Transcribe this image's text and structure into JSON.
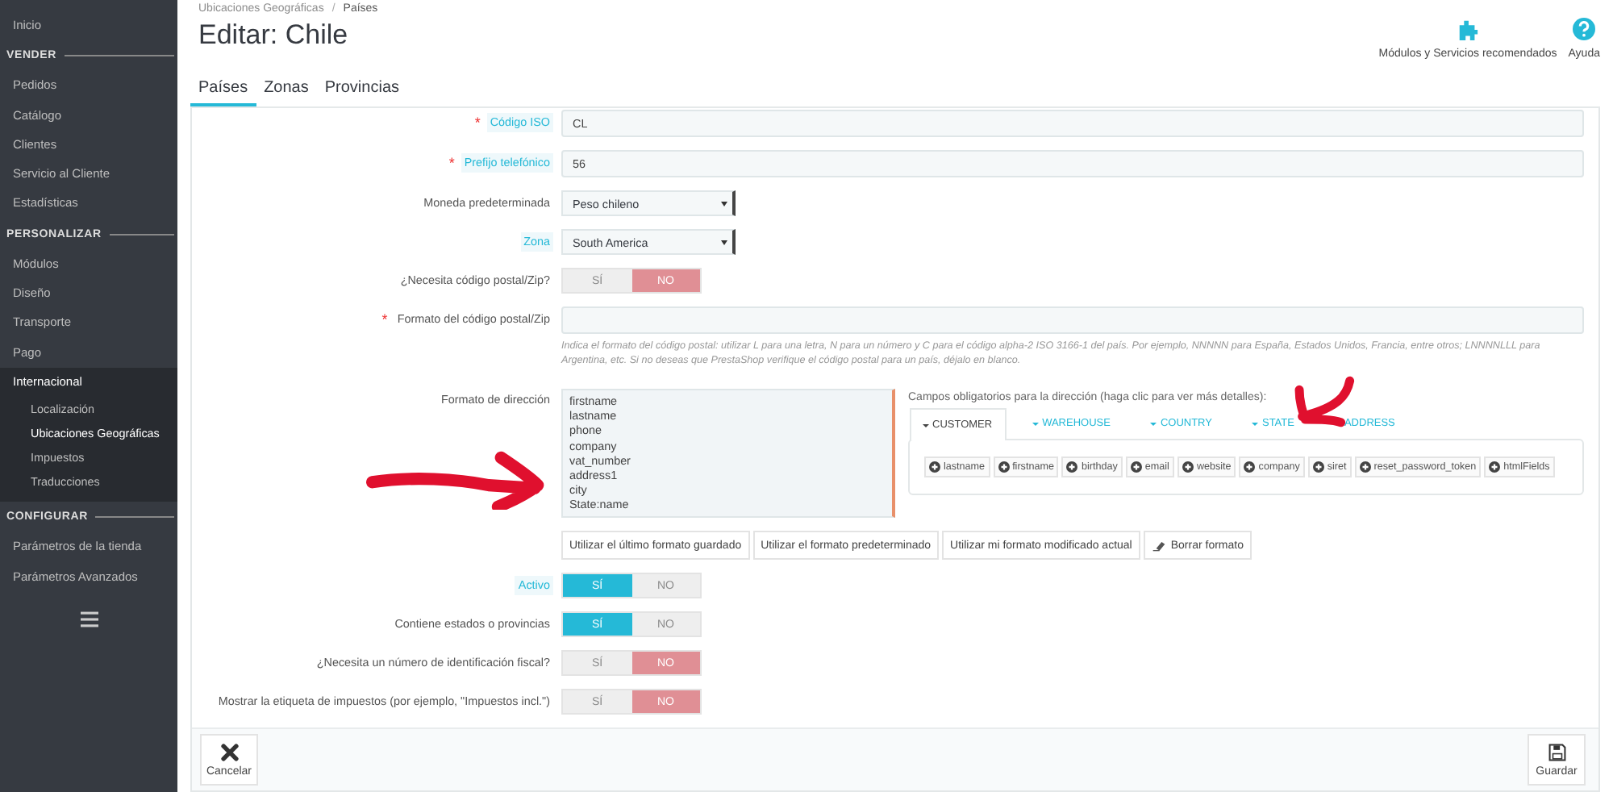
{
  "sidebar": {
    "items": [
      {
        "kind": "link",
        "label": "Inicio",
        "selected": false
      },
      {
        "kind": "heading",
        "label": "VENDER"
      },
      {
        "kind": "link",
        "label": "Pedidos",
        "selected": false
      },
      {
        "kind": "link",
        "label": "Catálogo",
        "selected": false
      },
      {
        "kind": "link",
        "label": "Clientes",
        "selected": false
      },
      {
        "kind": "link",
        "label": "Servicio al Cliente",
        "selected": false
      },
      {
        "kind": "link",
        "label": "Estadísticas",
        "selected": false
      },
      {
        "kind": "heading",
        "label": "PERSONALIZAR"
      },
      {
        "kind": "link",
        "label": "Módulos",
        "selected": false
      },
      {
        "kind": "link",
        "label": "Diseño",
        "selected": false
      },
      {
        "kind": "link",
        "label": "Transporte",
        "selected": false
      },
      {
        "kind": "link",
        "label": "Pago",
        "selected": false
      },
      {
        "kind": "link",
        "label": "Internacional",
        "expanded": true,
        "children": [
          {
            "label": "Localización",
            "selected": false
          },
          {
            "label": "Ubicaciones Geográficas",
            "selected": true
          },
          {
            "label": "Impuestos",
            "selected": false
          },
          {
            "label": "Traducciones",
            "selected": false
          }
        ]
      },
      {
        "kind": "heading",
        "label": "CONFIGURAR"
      },
      {
        "kind": "link",
        "label": "Parámetros de la tienda",
        "selected": false
      },
      {
        "kind": "link",
        "label": "Parámetros Avanzados",
        "selected": false
      }
    ]
  },
  "breadcrumb": [
    "Ubicaciones Geográficas",
    "/",
    "Países"
  ],
  "title": "Editar: Chile",
  "toolbar": [
    {
      "kind": "modules",
      "label": "Módulos y Servicios recomendados"
    },
    {
      "kind": "help",
      "label": "Ayuda"
    }
  ],
  "tabs": [
    {
      "label": "Países",
      "selected": true
    },
    {
      "label": "Zonas",
      "selected": false
    },
    {
      "label": "Provincias",
      "selected": false
    }
  ],
  "form": {
    "fields": [
      {
        "kind": "text",
        "label": "Código ISO",
        "required_mark": "*",
        "tooltip": true,
        "value": "CL"
      },
      {
        "kind": "text",
        "label": "Prefijo telefónico",
        "required_mark": "*",
        "tooltip": true,
        "value": "56"
      },
      {
        "kind": "select",
        "label": "Moneda predeterminada",
        "tooltip": false,
        "value": "Peso chileno"
      },
      {
        "kind": "select",
        "label": "Zona",
        "tooltip": true,
        "value": "South America"
      },
      {
        "kind": "toggle",
        "label": "¿Necesita código postal/Zip?",
        "tooltip": false,
        "options": [
          {
            "label": "SÍ",
            "selected": false
          },
          {
            "label": "NO",
            "selected": true
          }
        ]
      },
      {
        "kind": "text",
        "label": "Formato del código postal/Zip",
        "required_mark": "*",
        "tooltip": false,
        "help": "Indica el formato del código postal: utilizar L para una letra, N para un número y C para el código alpha-2 ISO 3166-1 del país. Por ejemplo, NNNNN para España, Estados Unidos, Francia, entre otros; LNNNNLLL para Argentina, etc. Si no deseas que PrestaShop verifique el código postal para un país, déjalo en blanco."
      },
      {
        "kind": "address",
        "label": "Formato de dirección",
        "tooltip": false,
        "value": "firstname\nlastname\nphone\ncompany\nvat_number\naddress1\ncity\nState:name",
        "fields_heading": "Campos obligatorios para la dirección (haga clic para ver más detalles):",
        "field_tabs": [
          {
            "label": "CUSTOMER",
            "selected": true
          },
          {
            "label": "WAREHOUSE",
            "selected": false
          },
          {
            "label": "COUNTRY",
            "selected": false
          },
          {
            "label": "STATE",
            "selected": false
          },
          {
            "label": "ADDRESS",
            "selected": false
          }
        ],
        "chips": [
          "lastname",
          "firstname",
          "birthday",
          "email",
          "website",
          "company",
          "siret",
          "reset_password_token",
          "htmlFields"
        ],
        "buttons": [
          {
            "kind": "plain",
            "label": "Utilizar el último formato guardado"
          },
          {
            "kind": "plain",
            "label": "Utilizar el formato predeterminado"
          },
          {
            "kind": "plain",
            "label": "Utilizar mi formato modificado actual"
          },
          {
            "kind": "clear",
            "label": "Borrar formato"
          }
        ]
      },
      {
        "kind": "toggle",
        "label": "Activo",
        "tooltip": true,
        "options": [
          {
            "label": "SÍ",
            "selected": true
          },
          {
            "label": "NO",
            "selected": false
          }
        ]
      },
      {
        "kind": "toggle",
        "label": "Contiene estados o provincias",
        "tooltip": false,
        "options": [
          {
            "label": "SÍ",
            "selected": true
          },
          {
            "label": "NO",
            "selected": false
          }
        ]
      },
      {
        "kind": "toggle",
        "label": "¿Necesita un número de identificación fiscal?",
        "tooltip": false,
        "options": [
          {
            "label": "SÍ",
            "selected": false
          },
          {
            "label": "NO",
            "selected": true
          }
        ]
      },
      {
        "kind": "toggle",
        "label": "Mostrar la etiqueta de impuestos (por ejemplo, \"Impuestos incl.\")",
        "tooltip": false,
        "options": [
          {
            "label": "SÍ",
            "selected": false
          },
          {
            "label": "NO",
            "selected": true
          }
        ]
      }
    ]
  },
  "footer": [
    {
      "kind": "cancel",
      "label": "Cancelar"
    },
    {
      "kind": "save",
      "label": "Guardar"
    }
  ]
}
